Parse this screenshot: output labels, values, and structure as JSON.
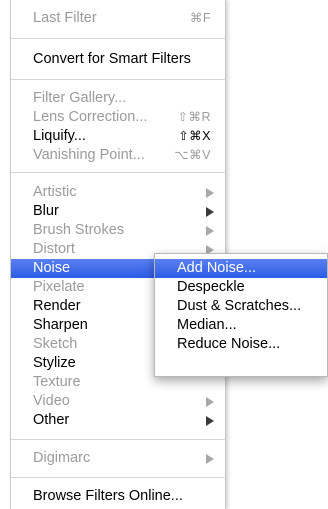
{
  "menu": {
    "items": [
      {
        "label": "Last Filter",
        "shortcut": "⌘F",
        "disabled": true
      },
      {
        "label": "Convert for Smart Filters"
      },
      {
        "label": "Filter Gallery...",
        "disabled": true
      },
      {
        "label": "Lens Correction...",
        "shortcut": "⇧⌘R",
        "disabled": true
      },
      {
        "label": "Liquify...",
        "shortcut": "⇧⌘X"
      },
      {
        "label": "Vanishing Point...",
        "shortcut": "⌥⌘V",
        "disabled": true
      },
      {
        "label": "Artistic",
        "disabled": true
      },
      {
        "label": "Blur"
      },
      {
        "label": "Brush Strokes",
        "disabled": true
      },
      {
        "label": "Distort",
        "disabled": true
      },
      {
        "label": "Noise",
        "highlighted": true
      },
      {
        "label": "Pixelate",
        "disabled": true
      },
      {
        "label": "Render"
      },
      {
        "label": "Sharpen"
      },
      {
        "label": "Sketch",
        "disabled": true
      },
      {
        "label": "Stylize"
      },
      {
        "label": "Texture",
        "disabled": true
      },
      {
        "label": "Video",
        "disabled": true
      },
      {
        "label": "Other"
      },
      {
        "label": "Digimarc",
        "disabled": true
      },
      {
        "label": "Browse Filters Online..."
      }
    ]
  },
  "submenu": {
    "items": [
      {
        "label": "Add Noise...",
        "highlighted": true
      },
      {
        "label": "Despeckle"
      },
      {
        "label": "Dust & Scratches..."
      },
      {
        "label": "Median..."
      },
      {
        "label": "Reduce Noise..."
      }
    ]
  },
  "colors": {
    "highlight": "#2c5be6",
    "disabled_text": "#9b9b9b"
  }
}
